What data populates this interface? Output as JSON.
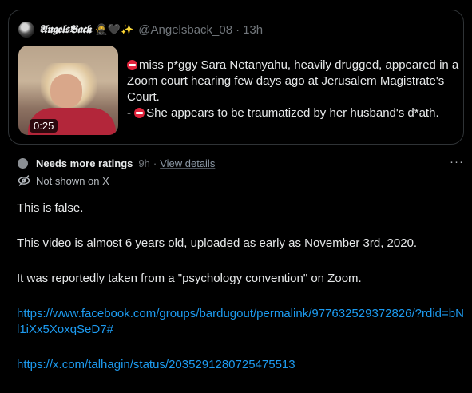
{
  "quoted_post": {
    "author_name": "𝕬𝖓𝖌𝖊𝖑𝖘𝕭𝖆𝖈𝖐",
    "author_emoji": "🥷🖤✨",
    "handle": "@Angelsback_08",
    "time": "13h",
    "video_duration": "0:25",
    "text_line_1": "miss p*ggy Sara Netanyahu, heavily drugged, appeared in a Zoom court hearing few days ago at Jerusalem Magistrate's Court.",
    "text_line_2_prefix": "- ",
    "text_line_2": "She appears to be traumatized by her husband's d*ath."
  },
  "note": {
    "status": "Needs more ratings",
    "time": "9h",
    "view_details": "View details",
    "visibility": "Not shown on X",
    "paragraphs": [
      "This is false.",
      "This video is almost 6 years old, uploaded as early as November 3rd, 2020.",
      "It was reportedly taken from a \"psychology convention\" on Zoom."
    ],
    "link_1": "https://www.facebook.com/groups/bardugout/permalink/977632529372826/?rdid=bNl1iXx5XoxqSeD7#",
    "link_2": "https://x.com/talhagin/status/2035291280725475513"
  },
  "colors": {
    "background": "#000000",
    "text": "#e7e9ea",
    "muted": "#71767b",
    "link": "#1d9bf0",
    "border": "#2f3336"
  }
}
